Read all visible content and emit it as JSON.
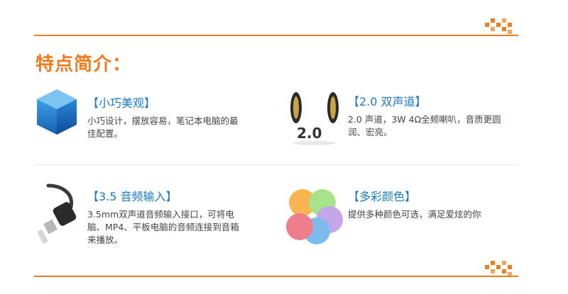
{
  "section_title": "特点简介：",
  "colors": {
    "accent": "#ef7d22",
    "title_blue": "#1a7ac2",
    "text": "#444444"
  },
  "features": [
    {
      "icon": "blue-cube-icon",
      "title": "【小巧美观】",
      "desc": "小巧设计，摆放容易，笔记本电脑的最佳配置。"
    },
    {
      "icon": "speaker-2-0-icon",
      "icon_label": "2.0",
      "title": "【2.0 双声道】",
      "desc": "2.0 声道，3W 4Ω全频喇叭，音质更圆润、宏亮。"
    },
    {
      "icon": "audio-plug-icon",
      "title": "【3.5 音频输入】",
      "desc": "3.5mm双声道音频输入接口，可将电脑、MP4、平板电脑的音频连接到音箱来播放。"
    },
    {
      "icon": "color-circles-icon",
      "title": "【多彩颜色】",
      "desc": "提供多种颜色可选，满足爱炫的你"
    }
  ]
}
